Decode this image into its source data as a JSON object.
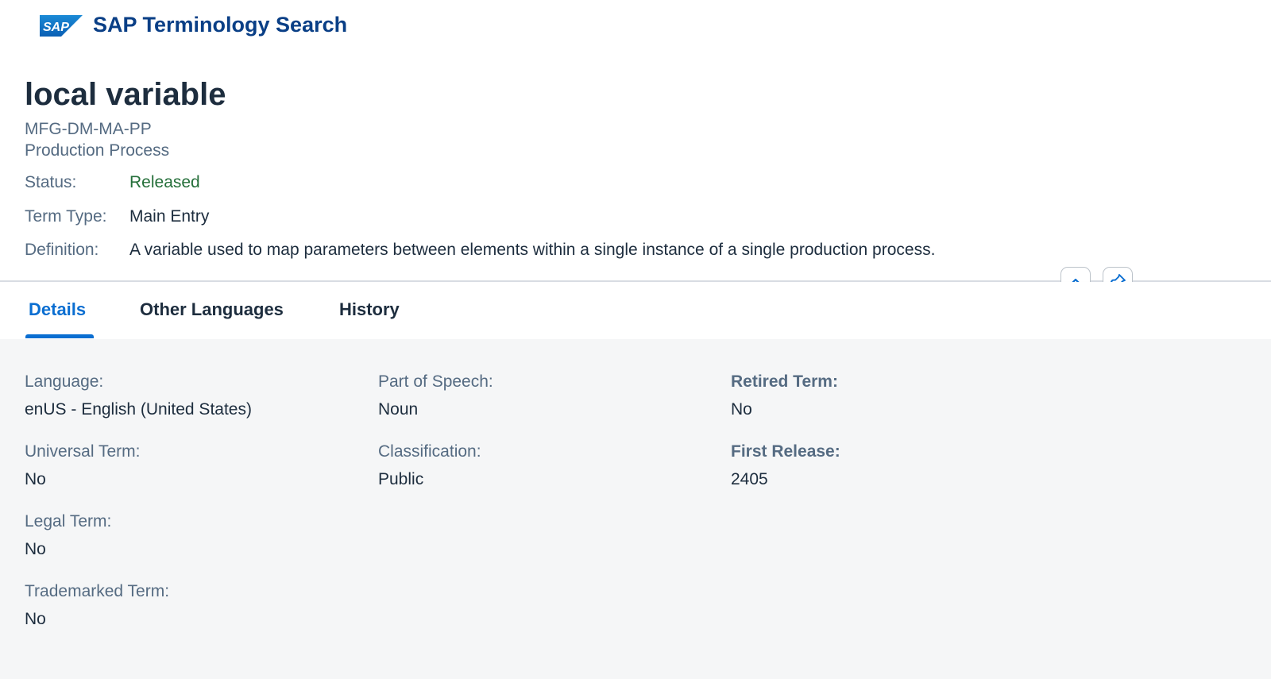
{
  "shell": {
    "logo_text": "SAP",
    "title": "SAP Terminology Search"
  },
  "header": {
    "term": "local variable",
    "component_code": "MFG-DM-MA-PP",
    "component_name": "Production Process",
    "attributes": [
      {
        "label": "Status:",
        "value": "Released"
      },
      {
        "label": "Term Type:",
        "value": "Main Entry"
      },
      {
        "label": "Definition:",
        "value": "A variable used to map parameters between elements within a single instance of a single production process."
      }
    ],
    "buttons": {
      "collapse_icon": "chevron-up-icon",
      "pin_icon": "pin-icon"
    },
    "colors": {
      "status_positive": "#256f3a",
      "brand_blue": "#0a3f86",
      "accent": "#0a6ed1"
    }
  },
  "tabs": [
    {
      "label": "Details",
      "selected": true
    },
    {
      "label": "Other Languages",
      "selected": false
    },
    {
      "label": "History",
      "selected": false
    }
  ],
  "details": {
    "language": {
      "label": "Language:",
      "value": "enUS - English (United States)"
    },
    "part_of_speech": {
      "label": "Part of Speech:",
      "value": "Noun"
    },
    "retired_term": {
      "label": "Retired Term:",
      "value": "No"
    },
    "universal_term": {
      "label": "Universal Term:",
      "value": "No"
    },
    "classification": {
      "label": "Classification:",
      "value": "Public"
    },
    "first_release": {
      "label": "First Release:",
      "value": "2405"
    },
    "legal_term": {
      "label": "Legal Term:",
      "value": "No"
    },
    "trademarked_term": {
      "label": "Trademarked Term:",
      "value": "No"
    }
  }
}
